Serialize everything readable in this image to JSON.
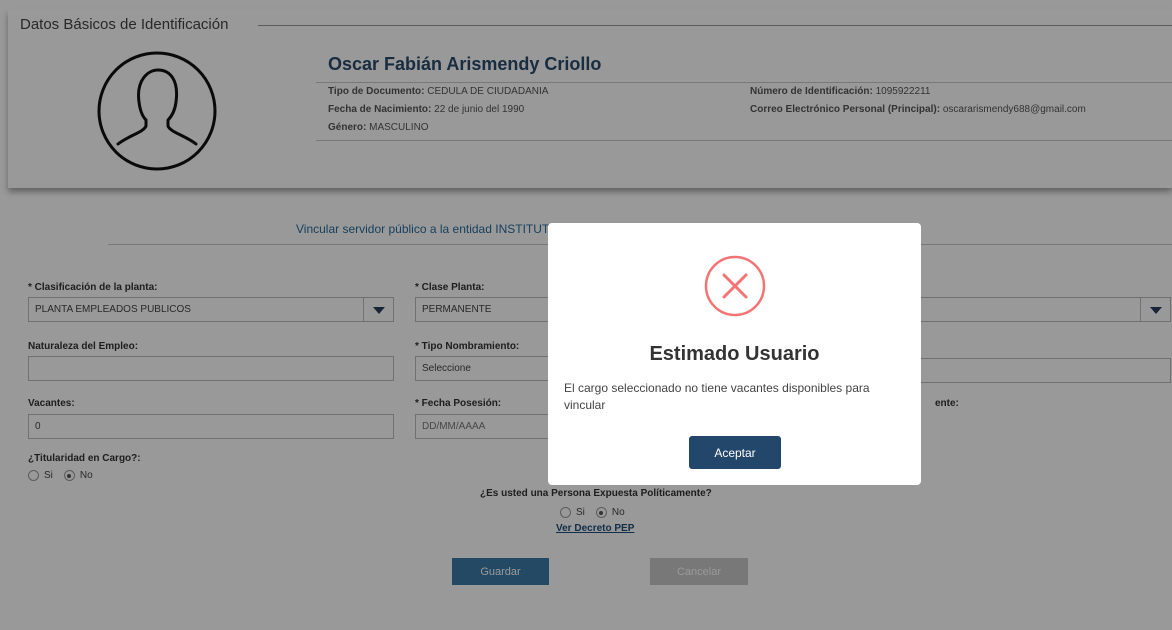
{
  "header": {
    "legend": "Datos Básicos de Identificación",
    "name": "Oscar Fabián Arismendy Criollo",
    "doc_type_label": "Tipo de Documento:",
    "doc_type_value": "CEDULA DE CIUDADANIA",
    "birth_label": "Fecha de Nacimiento:",
    "birth_value": "22 de junio del 1990",
    "gender_label": "Género:",
    "gender_value": "MASCULINO",
    "id_label": "Número de Identificación:",
    "id_value": "1095922211",
    "email_label": "Correo Electrónico Personal (Principal):",
    "email_value": "oscararismendy688@gmail.com"
  },
  "link_text": "Vincular servidor público a la entidad INSTITUTO",
  "form": {
    "clasificacion_label": "* Clasificación de la planta:",
    "clasificacion_value": "PLANTA EMPLEADOS PUBLICOS",
    "clase_label": "* Clase Planta:",
    "clase_value": "PERMANENTE",
    "naturaleza_label": "Naturaleza del Empleo:",
    "naturaleza_value": "",
    "tipo_nombramiento_label": "* Tipo Nombramiento:",
    "tipo_nombramiento_value": "Seleccione",
    "vacantes_label": "Vacantes:",
    "vacantes_value": "0",
    "fecha_posesion_label": "* Fecha Posesión:",
    "fecha_posesion_placeholder": "DD/MM/AAAA",
    "partial_label": "ente:",
    "titularidad_label": "¿Titularidad en Cargo?:",
    "si_label": "Si",
    "no_label": "No",
    "pep_question": "¿Es usted una Persona Expuesta Políticamente?",
    "pep_link": "Ver Decreto PEP",
    "save_label": "Guardar",
    "cancel_label": "Cancelar"
  },
  "modal": {
    "title": "Estimado Usuario",
    "message": "El cargo seleccionado no tiene vacantes disponibles para vincular",
    "accept_label": "Aceptar",
    "icon_color": "#f27474",
    "button_color": "#23466b"
  }
}
